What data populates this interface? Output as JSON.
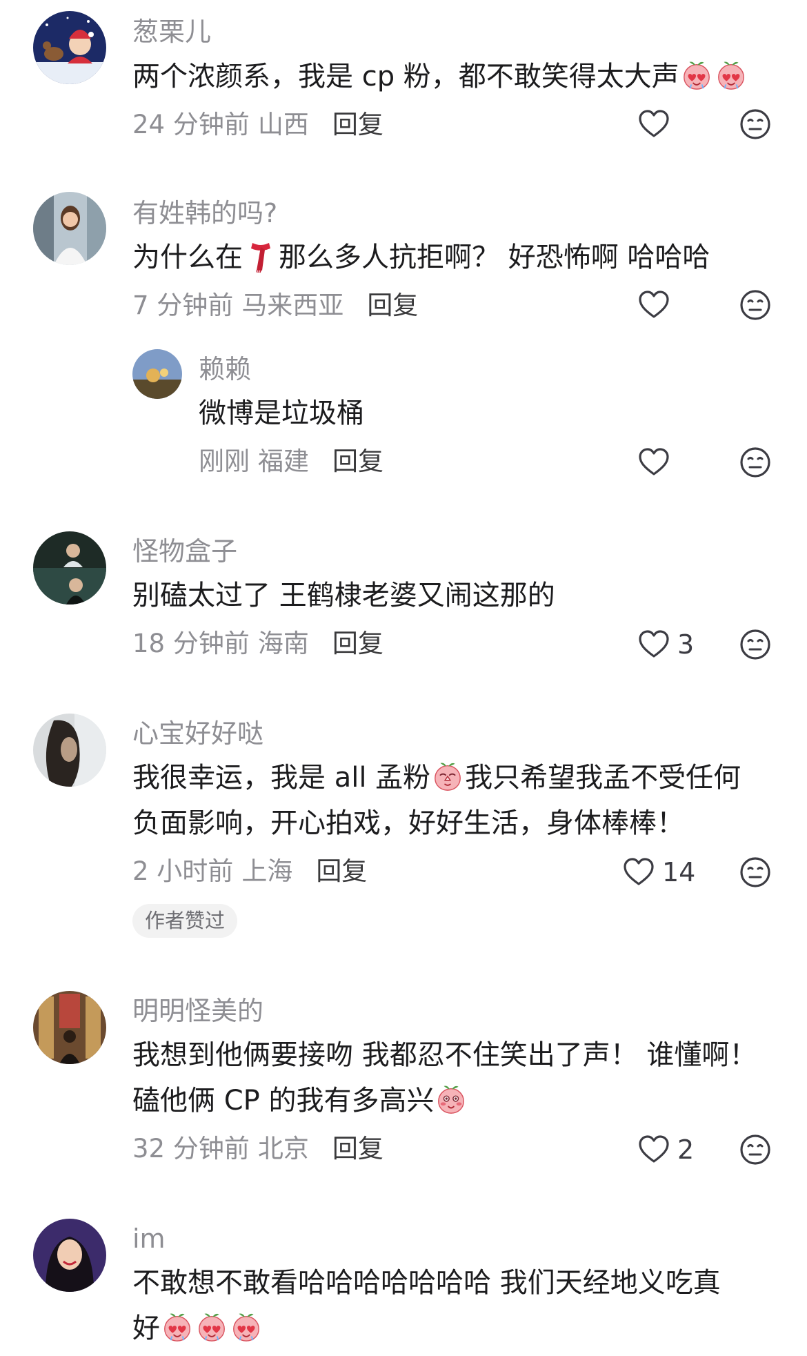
{
  "comments": [
    {
      "username": "葱栗儿",
      "text_before": "两个浓颜系，我是 cp 粉，都不敢笑得太大声",
      "time": "24 分钟前",
      "location": "山西",
      "reply_label": "回复",
      "like_count": ""
    },
    {
      "username": "有姓韩的吗?",
      "text_before": "为什么在",
      "text_after": "那么多人抗拒啊？ 好恐怖啊 哈哈哈",
      "time": "7 分钟前",
      "location": "马来西亚",
      "reply_label": "回复",
      "like_count": ""
    },
    {
      "username": "赖赖",
      "text_before": "微博是垃圾桶",
      "time": "刚刚",
      "location": "福建",
      "reply_label": "回复",
      "like_count": ""
    },
    {
      "username": "怪物盒子",
      "text_before": "别磕太过了 王鹤棣老婆又闹这那的",
      "time": "18 分钟前",
      "location": "海南",
      "reply_label": "回复",
      "like_count": "3"
    },
    {
      "username": "心宝好好哒",
      "line1_before": "我很幸运，我是 all 孟粉",
      "line1_after": "我只希望我孟不受任何",
      "line2": "负面影响，开心拍戏，好好生活，身体棒棒！",
      "time": "2 小时前",
      "location": "上海",
      "reply_label": "回复",
      "like_count": "14",
      "badge": "作者赞过"
    },
    {
      "username": "明明怪美的",
      "line1": "我想到他俩要接吻 我都忍不住笑出了声！ 谁懂啊！",
      "line2_before": "磕他俩 CP 的我有多高兴",
      "time": "32 分钟前",
      "location": "北京",
      "reply_label": "回复",
      "like_count": "2"
    },
    {
      "username": "im",
      "line1": "不敢想不敢看哈哈哈哈哈哈哈  我们天经地义吃真",
      "line2_before": "好"
    }
  ],
  "icons": {
    "like": "heart-outline-icon",
    "dislike": "neutral-face-icon",
    "emoji_love": "peach-heart-eyes-emoji",
    "emoji_pray": "peach-pleading-emoji",
    "emoji_shy": "peach-shy-emoji",
    "scarf": "red-scarf-emoji"
  },
  "colors": {
    "username": "#8e8e93",
    "meta": "#8e8e93",
    "badge_bg": "#f2f2f2"
  }
}
